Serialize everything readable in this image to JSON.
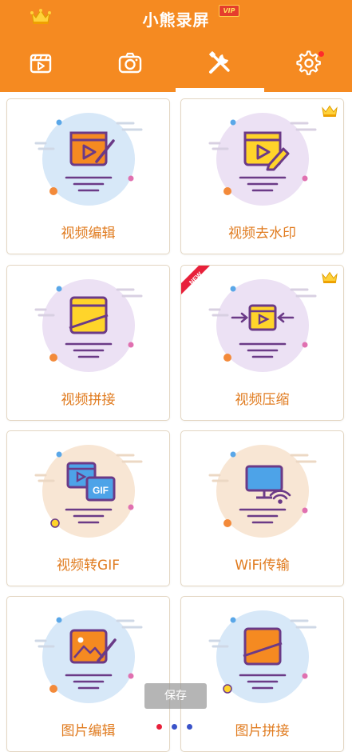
{
  "header": {
    "app_title": "小熊录屏",
    "vip_label": "VIP",
    "tabs": [
      {
        "name": "video-list",
        "icon": "clapperboard-icon"
      },
      {
        "name": "camera",
        "icon": "camera-icon"
      },
      {
        "name": "tools",
        "icon": "wrench-screwdriver-icon",
        "selected": true
      },
      {
        "name": "settings",
        "icon": "gear-icon",
        "has_notification_dot": true
      }
    ]
  },
  "cards": [
    {
      "label": "视频编辑",
      "icon": "video-edit-icon",
      "premium": false,
      "new": false
    },
    {
      "label": "视频去水印",
      "icon": "video-watermark-remove-icon",
      "premium": true,
      "new": false
    },
    {
      "label": "视频拼接",
      "icon": "video-merge-icon",
      "premium": false,
      "new": false
    },
    {
      "label": "视频压缩",
      "icon": "video-compress-icon",
      "premium": true,
      "new": true,
      "ribbon_text": "NEW"
    },
    {
      "label": "视频转GIF",
      "icon": "video-to-gif-icon",
      "premium": false,
      "new": false,
      "gif_text": "GIF"
    },
    {
      "label": "WiFi传输",
      "icon": "wifi-transfer-icon",
      "premium": false,
      "new": false
    },
    {
      "label": "图片编辑",
      "icon": "image-edit-icon",
      "premium": false,
      "new": false
    },
    {
      "label": "图片拼接",
      "icon": "image-merge-icon",
      "premium": false,
      "new": false
    }
  ],
  "toast": {
    "text": "保存"
  },
  "pager": {
    "dots": 3,
    "active_index": 0
  },
  "colors": {
    "brand": "#f58a21",
    "label": "#e07b1f",
    "accent_red": "#ff2b2b",
    "dot_blue": "#3a53c9"
  }
}
